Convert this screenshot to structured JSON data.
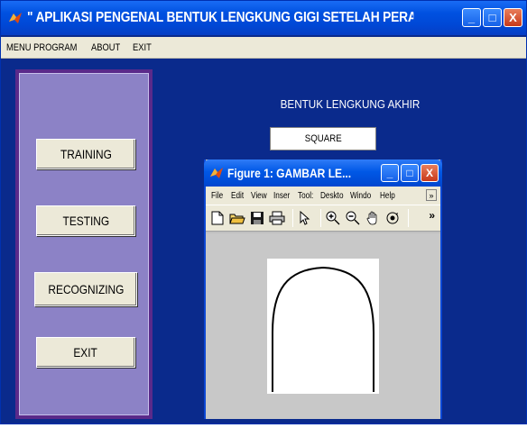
{
  "window": {
    "title": "\" APLIKASI PENGENAL BENTUK LENGKUNG GIGI SETELAH PERAWATAN O...",
    "controls": {
      "minimize": "_",
      "maximize": "□",
      "close": "X"
    }
  },
  "menu": {
    "items": [
      "MENU PROGRAM",
      "ABOUT",
      "EXIT"
    ]
  },
  "sidebar": {
    "buttons": [
      {
        "label": "TRAINING"
      },
      {
        "label": "TESTING"
      },
      {
        "label": "RECOGNIZING"
      },
      {
        "label": "EXIT"
      }
    ]
  },
  "result": {
    "title": "BENTUK LENGKUNG AKHIR",
    "value": "SQUARE"
  },
  "figure": {
    "title": "Figure 1: GAMBAR LE...",
    "menu": [
      "File",
      "Edit",
      "View",
      "Inser",
      "Tool:",
      "Deskto",
      "Windo",
      "Help"
    ],
    "menu_more": "»",
    "toolbar_more": "»",
    "toolbar": [
      "new-file-icon",
      "open-folder-icon",
      "save-icon",
      "print-icon",
      "pointer-icon",
      "zoom-in-icon",
      "zoom-out-icon",
      "pan-hand-icon",
      "rotate-3d-icon"
    ]
  },
  "colors": {
    "window_bg": "#0a2a8c",
    "panel_outer": "#5a2a8a",
    "panel_inner": "#8c82c6",
    "button_face": "#ece9d8"
  }
}
